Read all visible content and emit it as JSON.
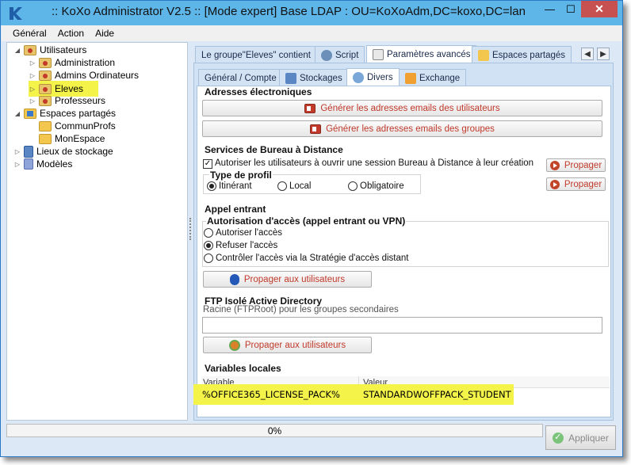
{
  "window": {
    "title": ":: KoXo Administrator V2.5 :: [Mode expert] Base LDAP : OU=KoXoAdm,DC=koxo,DC=lan",
    "icons": {
      "app": "koxo-k-icon",
      "minimize": "minimize-icon",
      "maximize": "maximize-icon",
      "close": "close-icon"
    }
  },
  "menu": {
    "items": [
      {
        "label": "Général"
      },
      {
        "label": "Action"
      },
      {
        "label": "Aide"
      }
    ]
  },
  "tree": {
    "items": [
      {
        "label": "Utilisateurs",
        "expander": "◢"
      },
      {
        "label": "Administration",
        "expander": "▷"
      },
      {
        "label": "Admins Ordinateurs",
        "expander": "▷"
      },
      {
        "label": "Eleves",
        "expander": "▷",
        "selected": true
      },
      {
        "label": "Professeurs",
        "expander": "▷"
      },
      {
        "label": "Espaces partagés",
        "expander": "◢"
      },
      {
        "label": "CommunProfs",
        "expander": ""
      },
      {
        "label": "MonEspace",
        "expander": ""
      },
      {
        "label": "Lieux de stockage",
        "expander": "▷"
      },
      {
        "label": "Modèles",
        "expander": "▷"
      }
    ]
  },
  "tabs_top": {
    "items": [
      {
        "label": "Le groupe\"Eleves\" contient"
      },
      {
        "label": "Script"
      },
      {
        "label": "Paramètres avancés",
        "active": true
      },
      {
        "label": "Espaces partagés"
      }
    ],
    "scroll_left": "◀",
    "scroll_right": "▶"
  },
  "tabs_sub": {
    "items": [
      {
        "label": "Général / Compte"
      },
      {
        "label": "Stockages"
      },
      {
        "label": "Divers",
        "active": true
      },
      {
        "label": "Exchange"
      }
    ]
  },
  "email": {
    "title": "Adresses électroniques",
    "btn_users": "Générer les adresses emails des utilisateurs",
    "btn_groups": "Générer les adresses emails des groupes"
  },
  "rds": {
    "title": "Services de Bureau à Distance",
    "checkbox_label": "Autoriser les utilisateurs à ouvrir une session Bureau à Distance à leur création",
    "checkbox_checked": true,
    "checkbox_mark": "✓",
    "propagate_label": "Propager",
    "profile_title": "Type de profil",
    "profile_options": [
      {
        "label": "Itinérant",
        "checked": true
      },
      {
        "label": "Local",
        "checked": false
      },
      {
        "label": "Obligatoire",
        "checked": false
      }
    ]
  },
  "dialin": {
    "title": "Appel entrant",
    "auth_title": "Autorisation d'accès (appel entrant ou VPN)",
    "options": [
      {
        "label": "Autoriser l'accès",
        "checked": false
      },
      {
        "label": "Refuser l'accès",
        "checked": true
      },
      {
        "label": "Contrôler l'accès via la Stratégie d'accès distant",
        "checked": false
      }
    ],
    "propagate_label": "Propager aux utilisateurs"
  },
  "ftp": {
    "title": "FTP Isolé Active Directory",
    "subtitle": "Racine (FTPRoot) pour les groupes secondaires",
    "value": "",
    "propagate_label": "Propager aux utilisateurs"
  },
  "local_vars": {
    "title": "Variables locales",
    "columns": [
      "Variable",
      "Valeur"
    ],
    "rows": [
      {
        "variable": "%OFFICE365_LICENSE_PACK%",
        "value": "STANDARDWOFFPACK_STUDENT"
      }
    ]
  },
  "status": {
    "progress_text": "0%",
    "progress_value": 0,
    "apply_label": "Appliquer"
  },
  "colors": {
    "titlebar": "#5db5e8",
    "close": "#c75050",
    "highlight": "#f3f34a",
    "link_red": "#c0392b"
  }
}
